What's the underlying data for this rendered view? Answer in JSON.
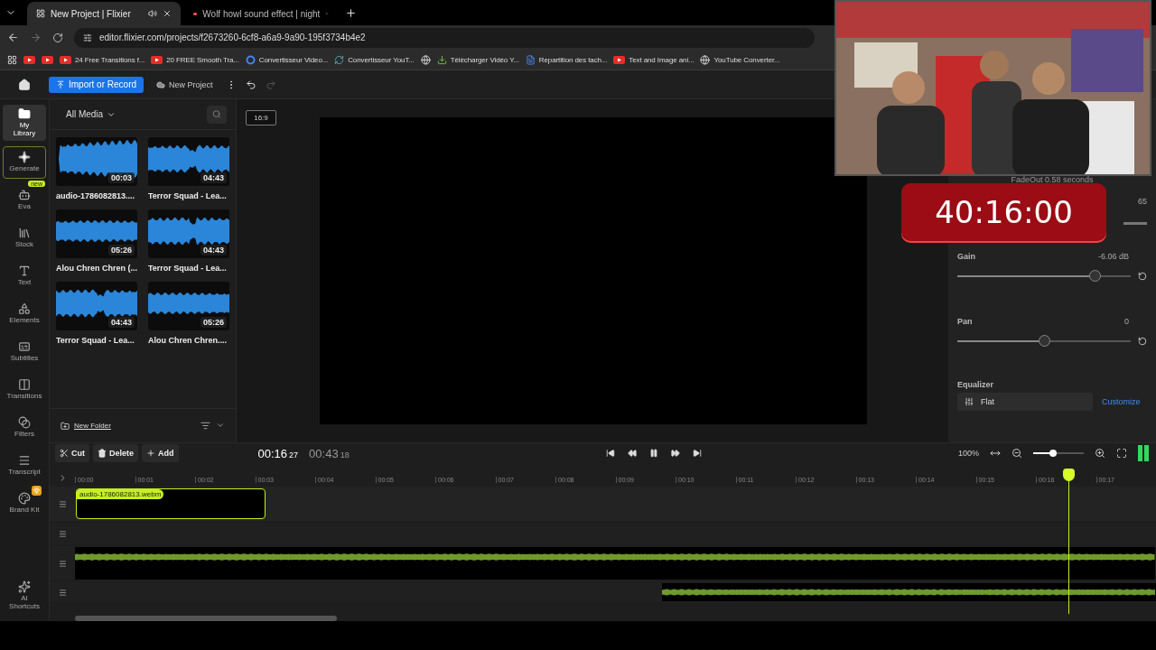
{
  "browser": {
    "tabs": [
      {
        "title": "New Project | Flixier",
        "selected": true,
        "audio": true
      },
      {
        "title": "Wolf howl sound effect | night",
        "selected": false,
        "audio": false
      }
    ],
    "url": "editor.flixier.com/projects/f2673260-6cf8-a6a9-9a90-195f3734b4e2",
    "bookmarks": [
      {
        "kind": "youtube"
      },
      {
        "kind": "youtube"
      },
      {
        "kind": "youtube",
        "label": "24 Free Transitions f..."
      },
      {
        "kind": "youtube",
        "label": "20 FREE Smooth Tra..."
      },
      {
        "kind": "google",
        "label": "Convertisseur Video..."
      },
      {
        "kind": "convert",
        "label": "Convertisseur YouT..."
      },
      {
        "kind": "globe"
      },
      {
        "kind": "download",
        "label": "Télécharger Vidéo Y..."
      },
      {
        "kind": "doc",
        "label": "Repartition des tach..."
      },
      {
        "kind": "youtube",
        "label": "Text and Image ani..."
      },
      {
        "kind": "globe",
        "label": "YouTube Converter..."
      }
    ]
  },
  "toolbar": {
    "import_button": "Import or Record",
    "project_name": "New Project"
  },
  "rail": [
    {
      "kind": "folder",
      "label": "My\nLibrary",
      "selected": true,
      "outlined": false,
      "premium": false
    },
    {
      "kind": "sparkle",
      "label": "Generate",
      "selected": false,
      "outlined": true,
      "premium": false
    },
    {
      "kind": "eva",
      "label": "Eva",
      "badge": "new",
      "selected": false,
      "outlined": false,
      "premium": false
    },
    {
      "kind": "stock",
      "label": "Stock",
      "selected": false,
      "outlined": false,
      "premium": false
    },
    {
      "kind": "text",
      "label": "Text",
      "selected": false,
      "outlined": false,
      "premium": false
    },
    {
      "kind": "shapes",
      "label": "Elements",
      "selected": false,
      "outlined": false,
      "premium": false
    },
    {
      "kind": "subtitles",
      "label": "Subtitles",
      "selected": false,
      "outlined": false,
      "premium": false
    },
    {
      "kind": "transitions",
      "label": "Transitions",
      "selected": false,
      "outlined": false,
      "premium": false
    },
    {
      "kind": "filters",
      "label": "Filters",
      "selected": false,
      "outlined": false,
      "premium": false
    },
    {
      "kind": "transcript",
      "label": "Transcript",
      "selected": false,
      "outlined": false,
      "premium": false
    },
    {
      "kind": "brand",
      "label": "Brand Kit",
      "selected": false,
      "outlined": false,
      "premium": true
    },
    {
      "kind": "ai",
      "label": "AI\nShortcuts",
      "selected": false,
      "outlined": false,
      "premium": false
    }
  ],
  "media": {
    "filter": "All Media",
    "items": [
      {
        "name": "audio-1786082813....",
        "duration": "00:03"
      },
      {
        "name": "Terror Squad - Lea...",
        "duration": "04:43"
      },
      {
        "name": "Alou Chren Chren (...",
        "duration": "05:26"
      },
      {
        "name": "Terror Squad - Lea...",
        "duration": "04:43"
      },
      {
        "name": "Terror Squad - Lea...",
        "duration": "04:43"
      },
      {
        "name": "Alou Chren Chren....",
        "duration": "05:26"
      }
    ],
    "new_folder": "New Folder"
  },
  "preview": {
    "aspect": "16:9"
  },
  "audio_panel": {
    "fade": "FadeOut 0.58 seconds",
    "volume": {
      "value": "65"
    },
    "gain": {
      "label": "Gain",
      "value": "-6.06 dB",
      "level": 0.79
    },
    "pan": {
      "label": "Pan",
      "value": "0",
      "level": 0.5
    },
    "equalizer": {
      "label": "Equalizer",
      "preset": "Flat",
      "link": "Customize"
    }
  },
  "timeline": {
    "actions": [
      "Cut",
      "Delete",
      "Add"
    ],
    "current": "00:16",
    "current_frames": "27",
    "total": "00:43",
    "total_frames": "18",
    "zoom": "100%",
    "zoom_slider": {
      "level": 0.4
    },
    "ticks": [
      "00:00",
      "00:01",
      "00:02",
      "00:03",
      "00:04",
      "00:05",
      "00:06",
      "00:07",
      "00:08",
      "00:09",
      "00:10",
      "00:11",
      "00:12",
      "00:13",
      "00:14",
      "00:15",
      "00:16",
      "00:17"
    ],
    "clip": "audio-1786082813.webm"
  },
  "overlay": {
    "timer": "40:16:00"
  }
}
